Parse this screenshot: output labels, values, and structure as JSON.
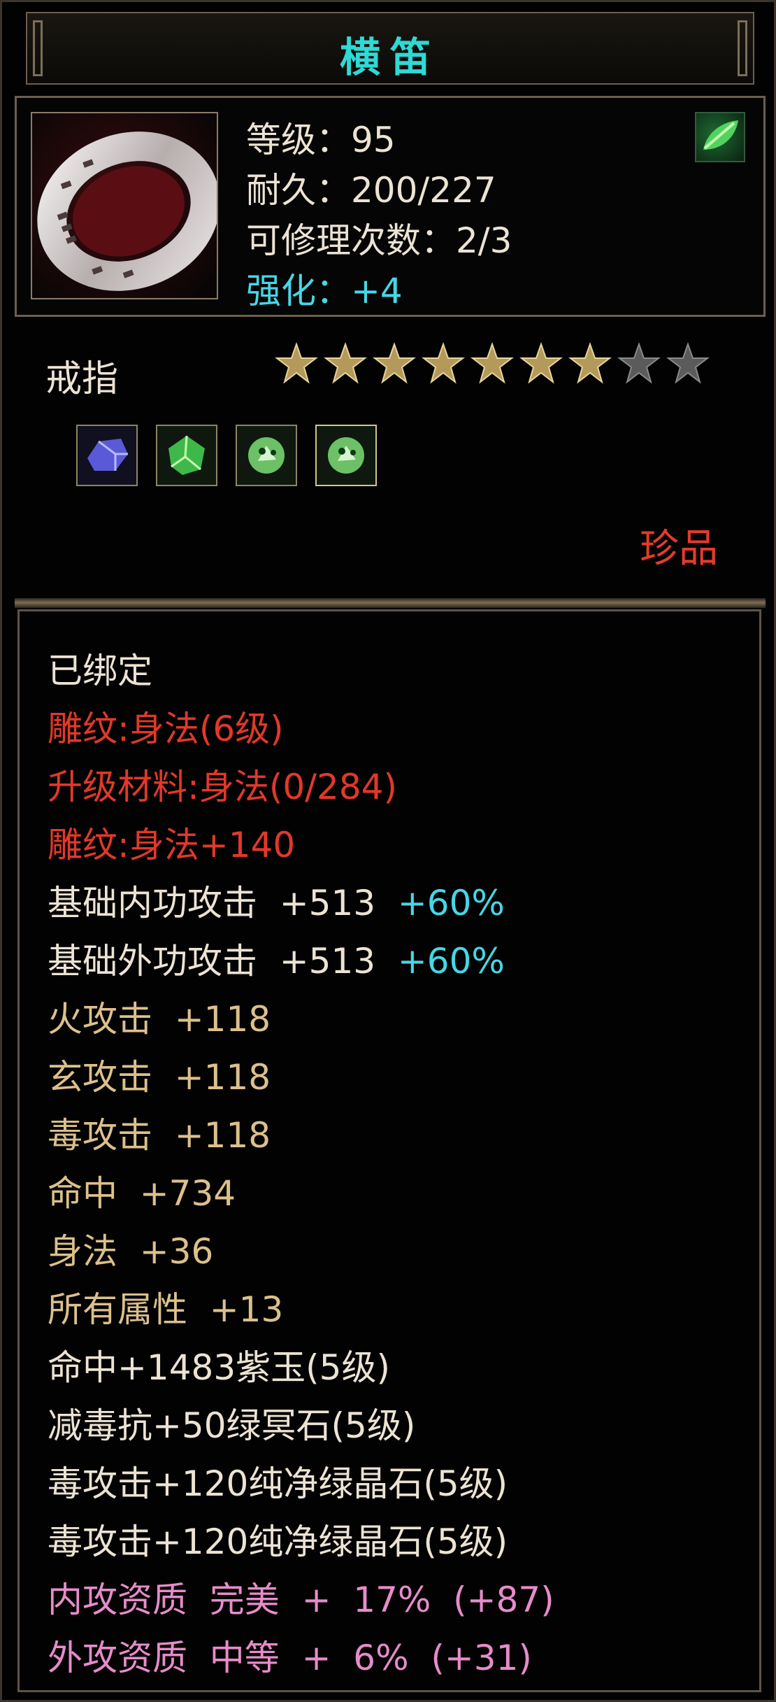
{
  "item": {
    "name": "横笛",
    "stats": [
      {
        "label": "等级",
        "value": "95"
      },
      {
        "label": "耐久",
        "value": "200/227"
      },
      {
        "label": "可修理次数",
        "value": "2/3"
      },
      {
        "label": "强化",
        "value": "+4"
      }
    ],
    "type": "戒指",
    "stars": {
      "filled": 7,
      "total": 9
    },
    "gems": [
      "purple-gem-icon",
      "green-gem-icon",
      "green-crystal-icon",
      "green-crystal-icon"
    ],
    "rarity": "珍品"
  },
  "attributes": [
    {
      "text": "已绑定",
      "color": "white"
    },
    {
      "text": "雕纹:身法(6级)",
      "color": "red"
    },
    {
      "text": "升级材料:身法(0/284)",
      "color": "red"
    },
    {
      "text": "雕纹:身法+140",
      "color": "red"
    },
    {
      "text": "基础内功攻击  +513",
      "extra": "  +60%",
      "color": "white"
    },
    {
      "text": "基础外功攻击  +513",
      "extra": "  +60%",
      "color": "white"
    },
    {
      "text": "火攻击  +118",
      "color": "gold"
    },
    {
      "text": "玄攻击  +118",
      "color": "gold"
    },
    {
      "text": "毒攻击  +118",
      "color": "gold"
    },
    {
      "text": "命中  +734",
      "color": "gold"
    },
    {
      "text": "身法  +36",
      "color": "gold"
    },
    {
      "text": "所有属性  +13",
      "color": "gold"
    },
    {
      "text": "命中+1483紫玉(5级)",
      "color": "white"
    },
    {
      "text": "减毒抗+50绿冥石(5级)",
      "color": "white"
    },
    {
      "text": "毒攻击+120纯净绿晶石(5级)",
      "color": "white"
    },
    {
      "text": "毒攻击+120纯净绿晶石(5级)",
      "color": "white"
    },
    {
      "text": "内攻资质  完美  +  17%  (+87)",
      "color": "pink"
    },
    {
      "text": "外攻资质  中等  +  6%  (+31)",
      "color": "pink"
    }
  ],
  "colors": {
    "title": "#2fd9d4",
    "red": "#e2382a",
    "gold": "#dcc08c",
    "cyan": "#46d7e6",
    "pink": "#e78cca",
    "rarity": "#e53b2d"
  }
}
